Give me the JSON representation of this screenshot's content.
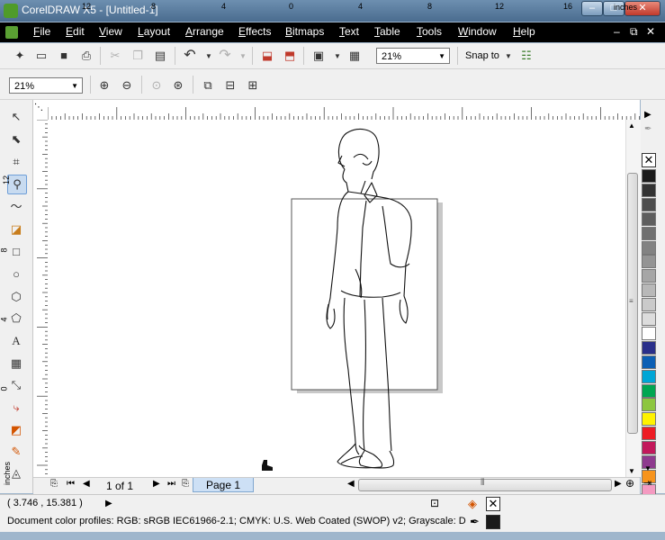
{
  "window": {
    "title": "CorelDRAW X5 - [Untitled-1]",
    "min": "–",
    "max": "□",
    "close": "✕"
  },
  "menu": {
    "items": [
      "File",
      "Edit",
      "View",
      "Layout",
      "Arrange",
      "Effects",
      "Bitmaps",
      "Text",
      "Table",
      "Tools",
      "Window",
      "Help"
    ],
    "mdi_min": "–",
    "mdi_restore": "⧉",
    "mdi_close": "✕"
  },
  "standard_toolbar": {
    "zoom_level": "21%",
    "snap_to_label": "Snap to"
  },
  "property_bar": {
    "zoom_level": "21%"
  },
  "ruler": {
    "h_labels": [
      "12",
      "8",
      "4",
      "0",
      "4",
      "8",
      "12",
      "16"
    ],
    "units": "inches",
    "v_labels": [
      "12",
      "8",
      "4",
      "0"
    ],
    "v_units": "inches"
  },
  "page_nav": {
    "page_count": "1 of 1",
    "page_tab": "Page 1"
  },
  "status": {
    "coords": "( 3.746 , 15.381 )",
    "color_profiles": "Document color profiles: RGB: sRGB IEC61966-2.1; CMYK: U.S. Web Coated (SWOP) v2; Grayscale: Dot Gai..."
  },
  "palette": {
    "colors": [
      "#1a1a1a",
      "#333333",
      "#4d4d4d",
      "#5e5e5e",
      "#707070",
      "#828282",
      "#949494",
      "#a6a6a6",
      "#b8b8b8",
      "#cacaca",
      "#dcdcdc",
      "#ffffff",
      "#2a2f8a",
      "#0b5fb4",
      "#00a6d6",
      "#00a651",
      "#8dc63f",
      "#fff200",
      "#ed1c24",
      "#c2185b",
      "#8e3a8e",
      "#f7941d",
      "#f49ac1"
    ]
  },
  "accent_colors": {
    "titlebar": "#5a7ca0",
    "menubar": "#000000",
    "page_tab": "#cde0f5"
  }
}
